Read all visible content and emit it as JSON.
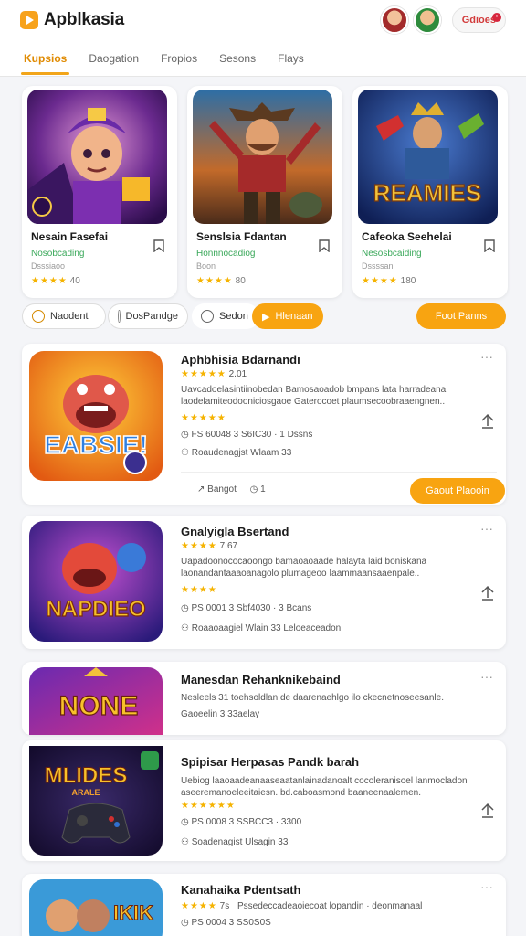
{
  "header": {
    "app_title": "Apblkasia",
    "account_label": "Gdioes"
  },
  "tabs": [
    "Kupsios",
    "Daogation",
    "Fropios",
    "Sesons",
    "Flays"
  ],
  "featured": [
    {
      "name": "Nesain Fasefai",
      "sub": "Nosobcading",
      "meta": "Dsssiaoo",
      "rating": "★★★★",
      "count": "40"
    },
    {
      "name": "Senslsia Fdantan",
      "sub": "Honnnocadiog",
      "meta": "Boon",
      "rating": "★★★★",
      "count": "80"
    },
    {
      "name": "Cafeoka Seehelai",
      "sub": "Nesosbcaiding",
      "meta": "Dssssan",
      "rating": "★★★★",
      "count": "180"
    }
  ],
  "featured_art_text": "REAMIES",
  "filters": {
    "chips": [
      "Naodent",
      "DosPandge",
      "Sedon",
      "Hlenaan"
    ],
    "cta": "Foot Panns"
  },
  "list": [
    {
      "title": "Aphbhisia Bdarnandı",
      "rating": "★★★★★",
      "rating_val": "2.01",
      "desc": "Uavcadoelasintiinobedan Bamosaoadob bmpans lata harradeana laodelamiteodooniciosgaoe Gaterocoet plaumsecoobraaengnen..",
      "stat": "FS 60048 3 S6IC30 · 1 Dssns",
      "tags": "Roaudenagjst  Wlaam 33",
      "art_text": "EABSIE!",
      "footer_action": "Bangot",
      "footer_count": "1",
      "cta": "Gaout Plaooin"
    },
    {
      "title": "Gnalyigla Bsertand",
      "rating": "★★★★",
      "rating_val": "7.67",
      "desc": "Uapadoonococaoongo bamaoaoaade halayta laid boniskana laonandantaaaoanagolo plumageoo Iaammaansaaenpale..",
      "stat": "PS 0001 3 Sbf4030 · 3 Bcans",
      "tags": "Roaaoaagiel  Wlain 33  Leloeaceadon",
      "art_text": "NAPDIEO"
    },
    {
      "title": "Manesdan Rehanknikebaind",
      "line1": "Nesleels 31 toehsoldlan de daarenaehlgo ilo ckecnetnoseesanle.",
      "line2": "Gaoeelin 3 33aelay",
      "art_text": "NONE"
    },
    {
      "title": "Spipisar Herpasas Pandk barah",
      "desc": "Uebiog laaoaadeanaaseaatanlainadanoalt cocoleranisoel lanmocladon aseeremanoeleeitaiesn. bd.caboasmond baaneenaalemen.",
      "rating": "★★★★★★",
      "rating_val": "",
      "stat": "PS 0008 3 SSBCC3 · 3300",
      "tags": "Soadenagist  Ulsagin 33",
      "art_text": "MLIDES",
      "art_sub": "ARALE"
    },
    {
      "title": "Kanahaika Pdentsath",
      "rating": "★★★★",
      "rating_val": "7s",
      "desc": "Pssedeccadeaoiecoat lopandin · deonmanaal",
      "stat": "PS 0004 3 SS0S0S",
      "art_text": "IKIK"
    }
  ],
  "colors": {
    "accent": "#f8a411",
    "rating": "#f5b301",
    "sub_green": "#3aa85a"
  }
}
